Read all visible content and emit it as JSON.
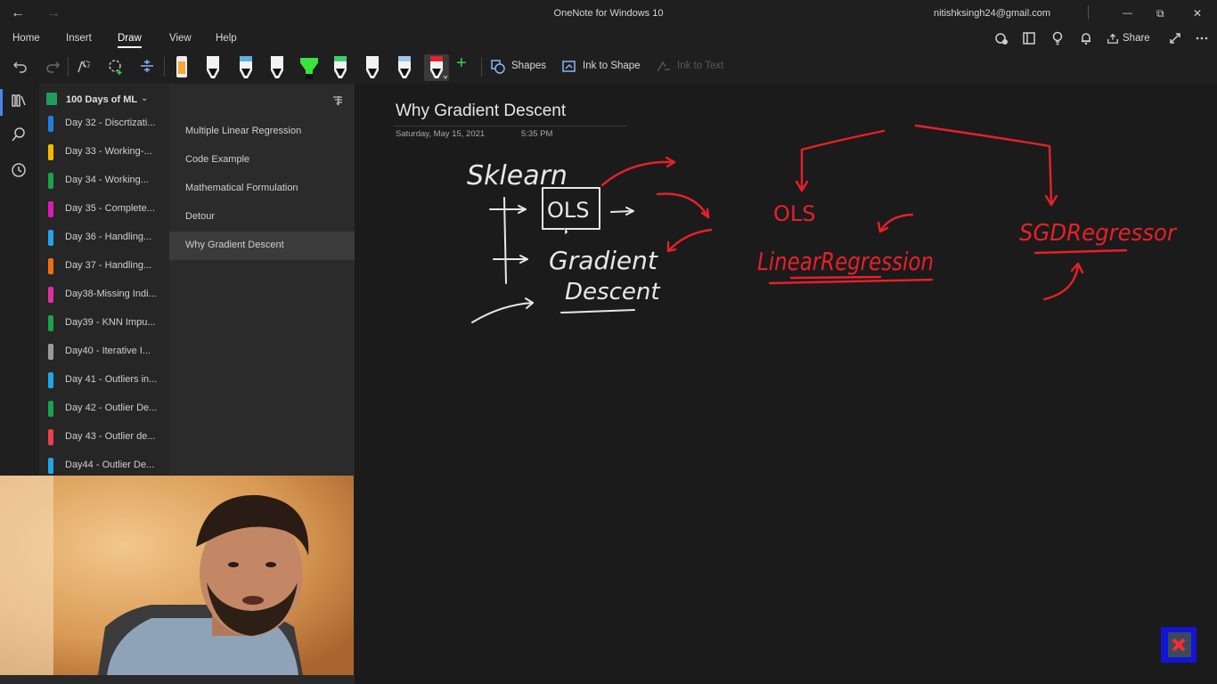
{
  "titlebar": {
    "app_title": "OneNote for Windows 10",
    "account_email": "nitishksingh24@gmail.com",
    "back_glyph": "←",
    "forward_glyph": "→",
    "minimize_glyph": "—",
    "restore_glyph": "⧉",
    "close_glyph": "✕"
  },
  "menu": {
    "tabs": [
      {
        "label": "Home"
      },
      {
        "label": "Insert"
      },
      {
        "label": "Draw"
      },
      {
        "label": "View"
      },
      {
        "label": "Help"
      }
    ],
    "active_tab": "Draw",
    "share_label": "Share"
  },
  "ribbon": {
    "shapes_label": "Shapes",
    "ink_to_shape_label": "Ink to Shape",
    "ink_to_text_label": "Ink to Text",
    "pens": [
      {
        "name": "highlighter-orange",
        "color": "#f6a63b"
      },
      {
        "name": "pen-white",
        "color": "#f2f2f2"
      },
      {
        "name": "pen-blue",
        "color": "#5fb0e6"
      },
      {
        "name": "pen-white-2",
        "color": "#f2f2f2"
      },
      {
        "name": "highlighter-green",
        "color": "#39e33b"
      },
      {
        "name": "pen-green",
        "color": "#3ecf6a"
      },
      {
        "name": "pen-white-3",
        "color": "#f2f2f2"
      },
      {
        "name": "pen-lightblue",
        "color": "#9fc6ec"
      },
      {
        "name": "pen-red",
        "color": "#e8202a"
      }
    ],
    "selected_pen": "pen-red"
  },
  "notebook": {
    "name": "100 Days of ML",
    "icon_color": "#1e9e5a"
  },
  "sections": [
    {
      "label": "Day 32 - Discrtizati...",
      "color": "#1e7fe0"
    },
    {
      "label": "Day 33 - Working-...",
      "color": "#f5b800"
    },
    {
      "label": "Day 34 - Working...",
      "color": "#1aa34a"
    },
    {
      "label": "Day 35 - Complete...",
      "color": "#e01bb4"
    },
    {
      "label": "Day 36 - Handling...",
      "color": "#1fa6e8"
    },
    {
      "label": "Day 37 - Handling...",
      "color": "#f0700f"
    },
    {
      "label": "Day38-Missing Indi...",
      "color": "#e02fa0"
    },
    {
      "label": "Day39 - KNN Impu...",
      "color": "#1aa34a"
    },
    {
      "label": "Day40 - Iterative I...",
      "color": "#9a9a9a"
    },
    {
      "label": "Day 41 - Outliers in...",
      "color": "#1fa6e8"
    },
    {
      "label": "Day 42 - Outlier De...",
      "color": "#1aa34a"
    },
    {
      "label": "Day 43 - Outlier de...",
      "color": "#e8424a"
    },
    {
      "label": "Day44 - Outlier De...",
      "color": "#1fa6e8"
    }
  ],
  "pages": [
    {
      "label": "Multiple Linear Regression"
    },
    {
      "label": "Code Example"
    },
    {
      "label": "Mathematical Formulation"
    },
    {
      "label": "Detour"
    },
    {
      "label": "Why Gradient Descent"
    }
  ],
  "selected_page": "Why Gradient Descent",
  "note": {
    "title": "Why Gradient Descent",
    "date": "Saturday, May 15, 2021",
    "time": "5:35 PM",
    "ink_white": [
      "Sklearn",
      "OLS",
      "Gradient",
      "Descent"
    ],
    "ink_red": [
      "OLS",
      "LinearRegression",
      "SGDRegressor"
    ],
    "ink_white_color": "#e8e8e8",
    "ink_red_color": "#e8202a"
  }
}
